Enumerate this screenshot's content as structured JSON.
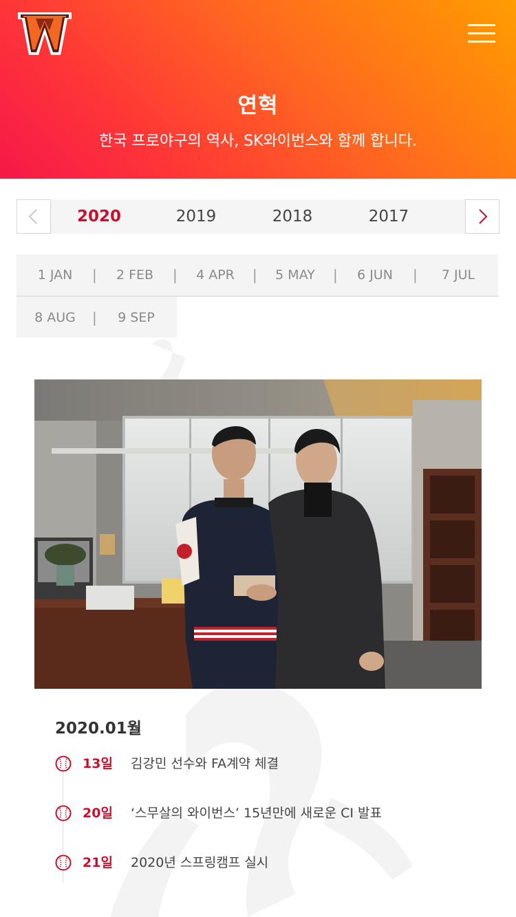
{
  "header": {
    "logo_icon": "wyverns-w-logo",
    "menu_icon": "hamburger-menu-icon",
    "title": "연혁",
    "subtitle": "한국 프로야구의 역사, SK와이번스와 함께 합니다.",
    "gradient_colors": [
      "#f51849",
      "#ff3438",
      "#ff6a1e",
      "#ff9d00"
    ]
  },
  "years": {
    "prev_icon": "chevron-left-icon",
    "next_icon": "chevron-right-icon",
    "items": [
      "2020",
      "2019",
      "2018",
      "2017"
    ],
    "active": "2020"
  },
  "months": {
    "items": [
      "1 JAN",
      "2 FEB",
      "4 APR",
      "5 MAY",
      "6 JUN",
      "7 JUL",
      "8 AUG",
      "9 SEP"
    ],
    "separator": "|"
  },
  "photo": {
    "description_icon": "contract-signing-photo"
  },
  "content": {
    "heading": "2020.01월",
    "events": [
      {
        "day": "13일",
        "text": "김강민 선수와 FA계약 체결"
      },
      {
        "day": "20일",
        "text": "‘스무살의 와이번스’ 15년만에 새로운 CI 발표"
      },
      {
        "day": "21일",
        "text": "2020년 스프링캠프 실시"
      }
    ]
  },
  "colors": {
    "accent": "#c8102e",
    "tab_bg": "#f4f4f4"
  }
}
